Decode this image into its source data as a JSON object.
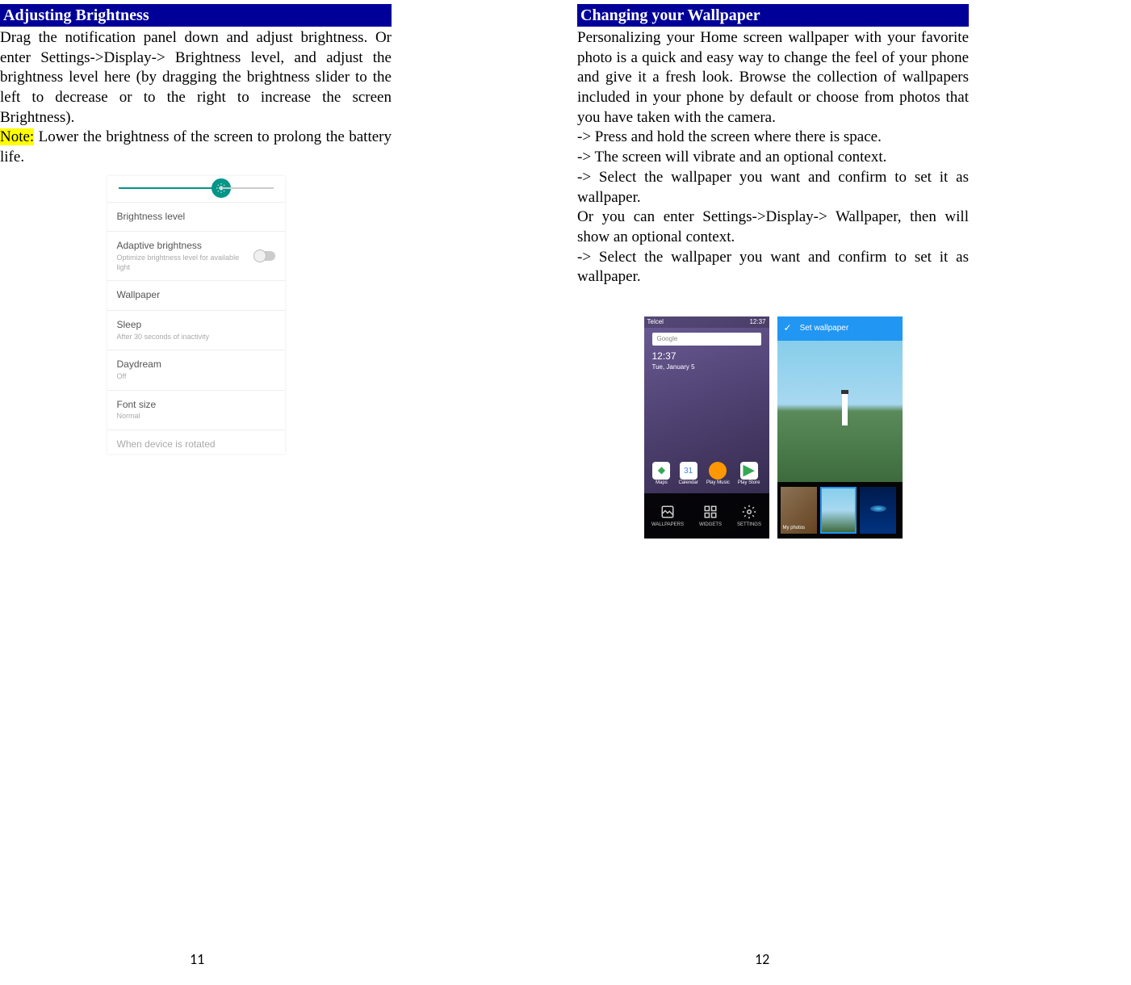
{
  "left": {
    "header": "Adjusting Brightness",
    "para1": "Drag the notification panel down and adjust brightness. Or enter Settings->Display-> Brightness level, and adjust the brightness level here (by dragging the brightness slider to the left to decrease or to the right to increase the screen Brightness).",
    "note_label": "Note:",
    "note_text": " Lower the brightness of the screen to prolong the battery life.",
    "settings": {
      "brightness": "Brightness level",
      "adaptive_title": "Adaptive brightness",
      "adaptive_sub": "Optimize brightness level for available light",
      "wallpaper": "Wallpaper",
      "sleep_title": "Sleep",
      "sleep_sub": "After 30 seconds of inactivity",
      "daydream_title": "Daydream",
      "daydream_sub": "Off",
      "font_title": "Font size",
      "font_sub": "Normal",
      "rotate": "When device is rotated"
    },
    "page_num": "11"
  },
  "right": {
    "header": "Changing your Wallpaper",
    "para1": "Personalizing your Home screen wallpaper with your favorite photo is a quick and easy way to change the feel of your phone and give it a fresh look. Browse the collection of wallpapers included in your phone by default or choose from photos that you have taken with the camera.",
    "step1": "-> Press and hold the screen where there is space.",
    "step2": "-> The screen will vibrate and an optional context.",
    "step3": "-> Select the wallpaper you want and confirm to set it as wallpaper.",
    "para2": "Or you can enter Settings->Display-> Wallpaper, then will show an optional context.",
    "step4": "-> Select the wallpaper you want and confirm to set it as wallpaper.",
    "home": {
      "search": "Google",
      "carrier": "Telcel",
      "time": "12:37",
      "date": "Tue, January 5",
      "apps": {
        "a1": "Maps",
        "a2": "Calendar",
        "a3": "Play Music",
        "a4": "Play Store"
      },
      "opts": {
        "o1": "WALLPAPERS",
        "o2": "WIDGETS",
        "o3": "SETTINGS"
      }
    },
    "picker": {
      "title": "Set wallpaper",
      "myphotos": "My photos"
    },
    "page_num": "12"
  }
}
